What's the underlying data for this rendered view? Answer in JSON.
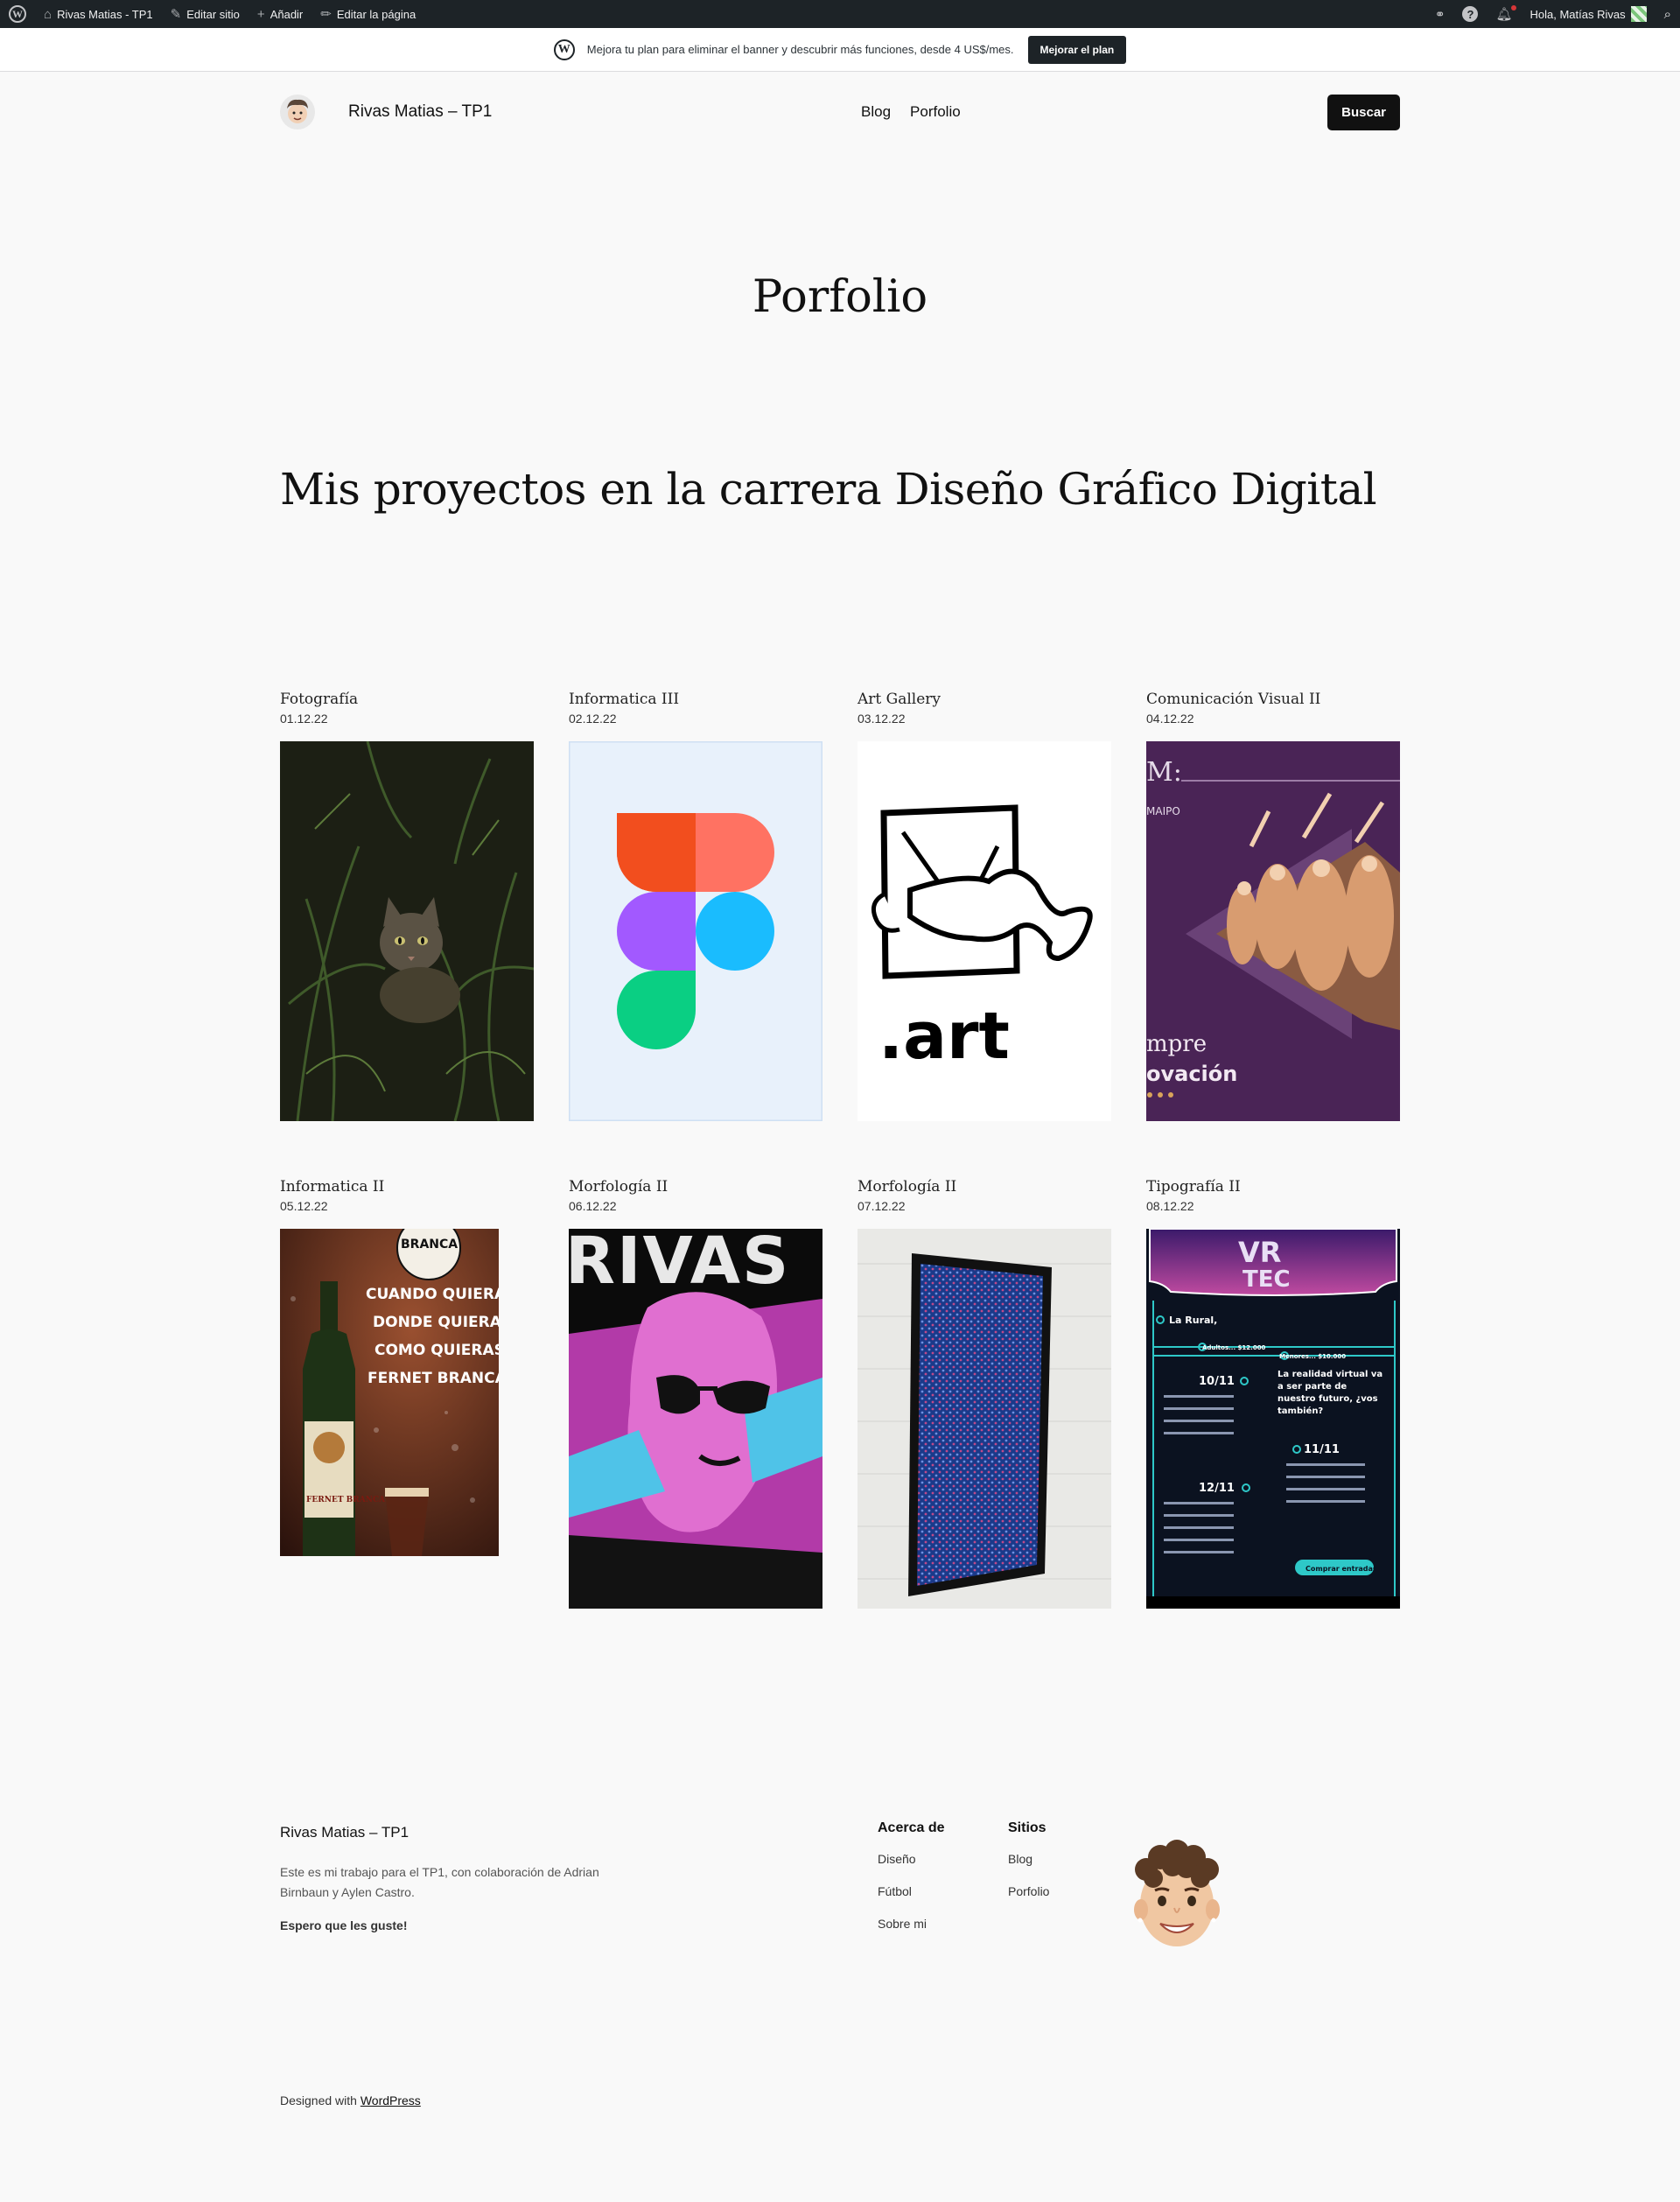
{
  "admin_bar": {
    "site_name": "Rivas Matias - TP1",
    "edit_site": "Editar sitio",
    "add_new": "Añadir",
    "edit_page": "Editar la página",
    "greeting": "Hola, Matías Rivas"
  },
  "banner": {
    "text": "Mejora tu plan para eliminar el banner y descubrir más funciones, desde 4 US$/mes.",
    "button": "Mejorar el plan"
  },
  "header": {
    "site_title": "Rivas Matias – TP1",
    "nav": [
      "Blog",
      "Porfolio"
    ],
    "search_button": "Buscar"
  },
  "page": {
    "title": "Porfolio",
    "heading": "Mis proyectos en la carrera Diseño Gráfico Digital"
  },
  "posts": [
    {
      "title": "Fotografía",
      "date": "01.12.22",
      "image": "cat-in-plants-photo"
    },
    {
      "title": "Informatica III",
      "date": "02.12.22",
      "image": "figma-logo"
    },
    {
      "title": "Art Gallery",
      "date": "03.12.22",
      "image": "art-gallery-logo"
    },
    {
      "title": "Comunicación Visual II",
      "date": "04.12.22",
      "image": "theatre-poster"
    },
    {
      "title": "Informatica II",
      "date": "05.12.22",
      "image": "fernet-branca-ad"
    },
    {
      "title": "Morfología II",
      "date": "06.12.22",
      "image": "rivas-pop-poster"
    },
    {
      "title": "Morfología II",
      "date": "07.12.22",
      "image": "framed-pattern-photo"
    },
    {
      "title": "Tipografía II",
      "date": "08.12.22",
      "image": "vr-tec-poster"
    }
  ],
  "img_text": {
    "art": ".art",
    "mpre": "mpre",
    "ovacion": "ovación",
    "maipo": "MAIPO",
    "branca": "BRANCA",
    "fernet_lines": [
      "CUANDO QUIERAS",
      "DONDE QUIERAS",
      "COMO QUIERAS",
      "FERNET BRANCA"
    ],
    "fernet_label": "FERNET BRANCA",
    "rivas": "RIVAS",
    "vr": "VR",
    "tec": "TEC",
    "la_rural": "La Rural,",
    "adultos": "Adultos... $12.000",
    "menores": "Menores... $10.000",
    "d1": "10/11",
    "d2": "11/11",
    "d3": "12/11",
    "quote": "La realidad virtual va a ser parte de nuestro futuro, ¿vos también?",
    "buy": "Comprar entradas"
  },
  "footer": {
    "title": "Rivas Matias – TP1",
    "description": "Este es mi trabajo para el TP1, con colaboración de Adrian Birnbaun y Aylen Castro.",
    "closing": "Espero que les guste!",
    "col1": {
      "heading": "Acerca de",
      "links": [
        "Diseño",
        "Fútbol",
        "Sobre mi"
      ]
    },
    "col2": {
      "heading": "Sitios",
      "links": [
        "Blog",
        "Porfolio"
      ]
    },
    "credits_prefix": "Designed with ",
    "credits_link": "WordPress"
  }
}
